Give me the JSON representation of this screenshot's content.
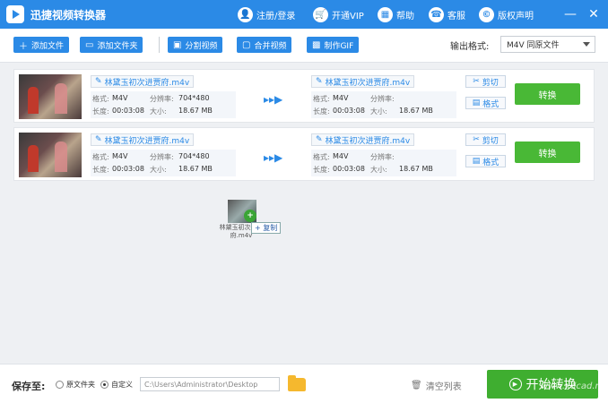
{
  "titlebar": {
    "title": "迅捷视频转换器",
    "items": [
      {
        "label": "注册/登录",
        "icon": "user-icon"
      },
      {
        "label": "开通VIP",
        "icon": "cart-icon"
      },
      {
        "label": "帮助",
        "icon": "grid-icon"
      },
      {
        "label": "客服",
        "icon": "headset-icon"
      },
      {
        "label": "版权声明",
        "icon": "copyright-icon"
      }
    ],
    "minimize": "—",
    "close": "✕"
  },
  "toolbar": {
    "add_file": "添加文件",
    "add_folder": "添加文件夹",
    "split_video": "分割视频",
    "merge_video": "合并视频",
    "make_gif": "制作GIF",
    "output_format_label": "输出格式:",
    "output_format_value": "M4V  同原文件"
  },
  "labels": {
    "format": "格式:",
    "resolution": "分辨率:",
    "duration": "长度:",
    "size": "大小:",
    "cut": "剪切",
    "fmt": "格式",
    "convert": "转换"
  },
  "files": [
    {
      "source_name": "林黛玉初次进贾府.m4v",
      "source": {
        "format": "M4V",
        "resolution": "704*480",
        "duration": "00:03:08",
        "size": "18.67 MB"
      },
      "target_name": "林黛玉初次进贾府.m4v",
      "target": {
        "format": "M4V",
        "resolution": "",
        "duration": "00:03:08",
        "size": "18.67 MB"
      }
    },
    {
      "source_name": "林黛玉初次进贾府.m4v",
      "source": {
        "format": "M4V",
        "resolution": "704*480",
        "duration": "00:03:08",
        "size": "18.67 MB"
      },
      "target_name": "林黛玉初次进贾府.m4v",
      "target": {
        "format": "M4V",
        "resolution": "",
        "duration": "00:03:08",
        "size": "18.67 MB"
      }
    }
  ],
  "drag": {
    "name": "林黛玉初次进贾府.m4v",
    "tip": "+ 复制"
  },
  "footer": {
    "save_label": "保存至:",
    "option_source": "原文件夹",
    "option_custom": "自定义",
    "path": "C:\\Users\\Administrator\\Desktop",
    "clear": "清空列表",
    "start": "开始转换"
  },
  "watermark": "www.xdcad.net"
}
